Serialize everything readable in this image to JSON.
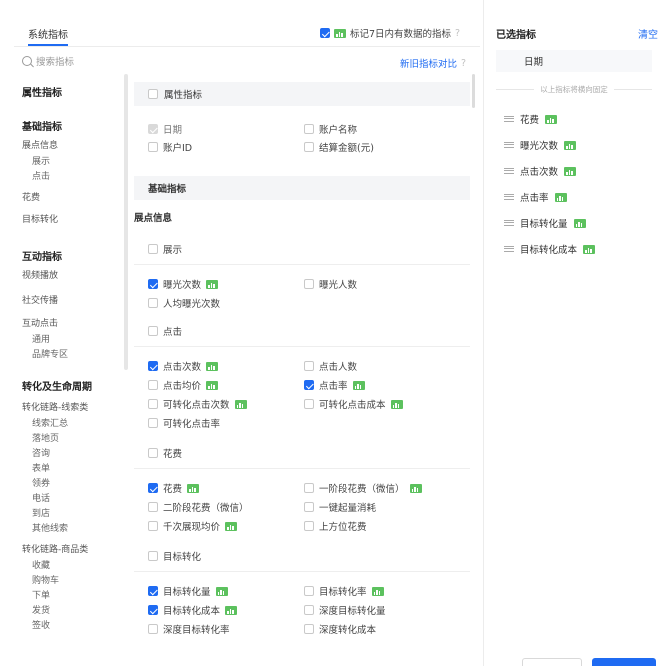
{
  "header": {
    "tab_label": "系统指标",
    "mark_label": "标记7日内有数据的指标",
    "help_glyph": "?"
  },
  "search": {
    "placeholder": "搜索指标",
    "compare_link": "新旧指标对比"
  },
  "nav": {
    "sections": [
      {
        "title": "属性指标",
        "items": []
      },
      {
        "title": "基础指标",
        "items": [
          {
            "label": "展点信息",
            "sub": [
              "展示",
              "点击"
            ]
          },
          {
            "label": "花费",
            "sub": []
          },
          {
            "label": "目标转化",
            "sub": []
          }
        ]
      },
      {
        "title": "互动指标",
        "items": [
          {
            "label": "视频播放",
            "sub": []
          },
          {
            "label": "社交传播",
            "sub": []
          },
          {
            "label": "互动点击",
            "sub": [
              "通用",
              "品牌专区"
            ]
          }
        ]
      },
      {
        "title": "转化及生命周期",
        "items": [
          {
            "label": "转化链路-线索类",
            "sub": [
              "线索汇总",
              "落地页",
              "咨询",
              "表单",
              "领券",
              "电话",
              "到店",
              "其他线索"
            ]
          },
          {
            "label": "转化链路-商品类",
            "sub": [
              "收藏",
              "购物车",
              "下单",
              "发货",
              "签收"
            ]
          }
        ]
      }
    ]
  },
  "main": {
    "attr_group": "属性指标",
    "attr_items": [
      "日期",
      "账户名称",
      "账户ID",
      "结算金额(元)"
    ],
    "basic_group": "基础指标",
    "zd_head": "展点信息",
    "show_head": "展示",
    "show_items": [
      "曝光次数",
      "曝光人数",
      "人均曝光次数"
    ],
    "click_head": "点击",
    "click_items": [
      "点击次数",
      "点击人数",
      "点击均价",
      "点击率",
      "可转化点击次数",
      "可转化点击成本",
      "可转化点击率"
    ],
    "cost_head": "花费",
    "cost_items": [
      "花费",
      "一阶段花费（微信）",
      "二阶段花费（微信）",
      "一键起量消耗",
      "千次展现均价",
      "上方位花费"
    ],
    "target_head": "目标转化",
    "target_items": [
      "目标转化量",
      "目标转化率",
      "目标转化成本",
      "深度目标转化量",
      "深度目标转化率",
      "深度转化成本"
    ]
  },
  "right": {
    "title": "已选指标",
    "clear": "清空",
    "fixed": "日期",
    "fixed_note": "以上指标将横向固定",
    "selected": [
      "花费",
      "曝光次数",
      "点击次数",
      "点击率",
      "目标转化量",
      "目标转化成本"
    ]
  },
  "colors": {
    "accent": "#1f6bf2",
    "data_tag": "#5cc15e"
  }
}
